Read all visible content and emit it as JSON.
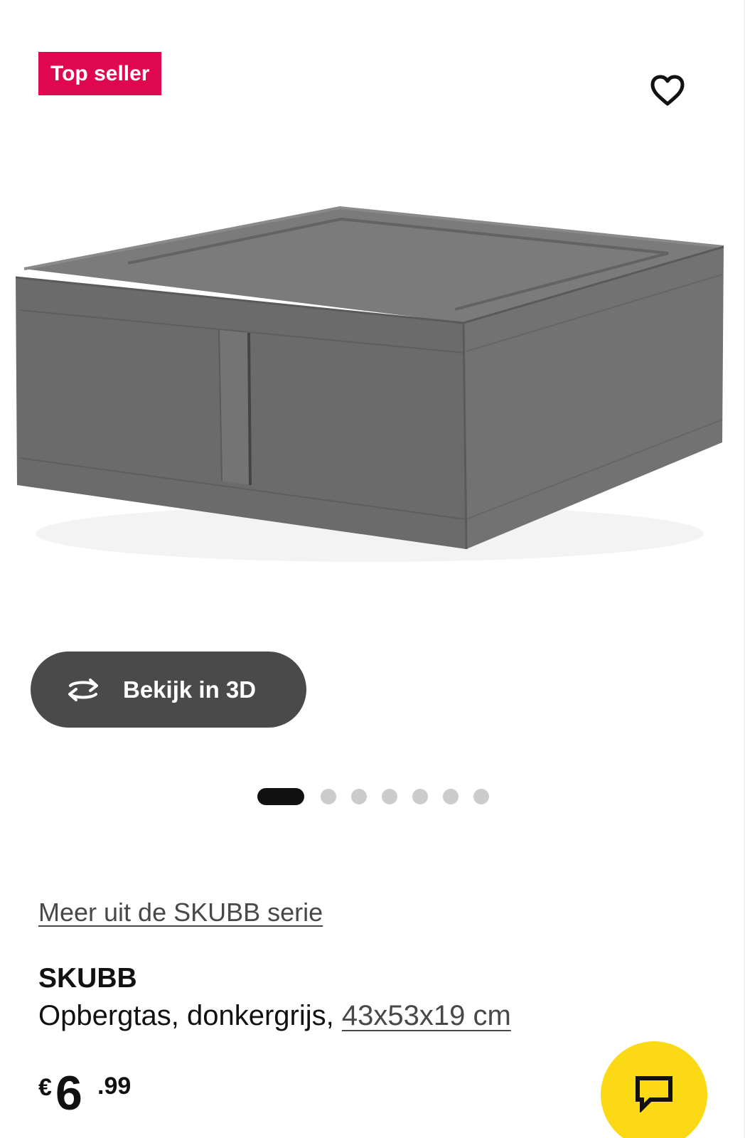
{
  "badge": {
    "label": "Top seller",
    "color": "#e00751"
  },
  "favorite": {
    "icon": "heart-outline-icon"
  },
  "media": {
    "product_image": "dark-grey-fabric-storage-case",
    "view3d": {
      "label": "Bekijk in 3D",
      "icon": "rotate-3d-icon"
    },
    "carousel": {
      "count": 7,
      "active_index": 0
    }
  },
  "product": {
    "series_link": "Meer uit de SKUBB serie",
    "name": "SKUBB",
    "description": "Opbergtas, donkergrijs,",
    "dimensions": "43x53x19 cm",
    "price": {
      "currency": "€",
      "integer": "6",
      "decimals": ".99"
    }
  },
  "chat": {
    "icon": "chat-bubble-icon",
    "color": "#fbd914"
  }
}
